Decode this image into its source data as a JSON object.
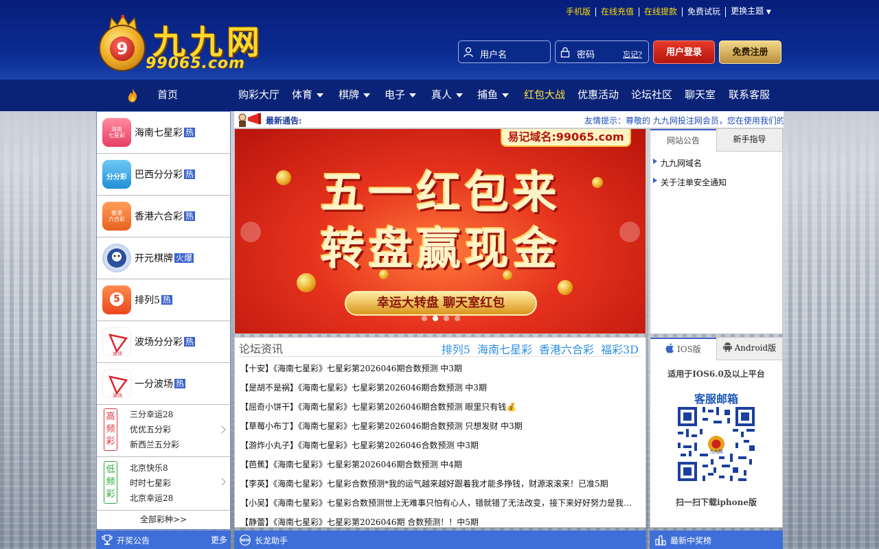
{
  "header": {
    "logo_cn": "九九网",
    "logo_en": "99065.com",
    "logo_ball_number": "9",
    "top_links": [
      "手机版",
      "在线充值",
      "在线提款",
      "免费试玩",
      "更换主题"
    ],
    "username_placeholder": "用户名",
    "password_placeholder": "密码",
    "forgot": "忘记?",
    "login_button": "用户登录",
    "register_button": "免费注册"
  },
  "nav": {
    "home": "首页",
    "items": [
      {
        "label": "购彩大厅",
        "dropdown": false,
        "highlight": false
      },
      {
        "label": "体育",
        "dropdown": true,
        "highlight": false
      },
      {
        "label": "棋牌",
        "dropdown": true,
        "highlight": false
      },
      {
        "label": "电子",
        "dropdown": true,
        "highlight": false
      },
      {
        "label": "真人",
        "dropdown": true,
        "highlight": false
      },
      {
        "label": "捕鱼",
        "dropdown": true,
        "highlight": false
      },
      {
        "label": "红包大战",
        "dropdown": false,
        "highlight": true
      },
      {
        "label": "优惠活动",
        "dropdown": false,
        "highlight": false
      },
      {
        "label": "论坛社区",
        "dropdown": false,
        "highlight": false
      },
      {
        "label": "聊天室",
        "dropdown": false,
        "highlight": false
      },
      {
        "label": "联系客服",
        "dropdown": false,
        "highlight": false
      }
    ]
  },
  "sidebar": {
    "games": [
      {
        "name": "海南七星彩",
        "badge": "热",
        "icon_text": "海南\n七星彩",
        "color": "#f0607a"
      },
      {
        "name": "巴西分分彩",
        "badge": "热",
        "icon_text": "分分彩",
        "color": "#35a7e8"
      },
      {
        "name": "香港六合彩",
        "badge": "热",
        "icon_text": "香港\n六合彩",
        "color": "#f27a3a"
      },
      {
        "name": "开元棋牌",
        "badge": "火爆",
        "icon_text": "",
        "color": "#e8eef8"
      },
      {
        "name": "排列5",
        "badge": "热",
        "icon_text": "5",
        "color": "#f2662e"
      },
      {
        "name": "波场分分彩",
        "badge": "热",
        "icon_text": "波场",
        "color": "#ffffff"
      },
      {
        "name": "一分波场",
        "badge": "热",
        "icon_text": "波场",
        "color": "#ffffff"
      }
    ],
    "groups": [
      {
        "tag": "高频彩",
        "color": "#d9363e",
        "items": [
          "三分幸运28",
          "优优五分彩",
          "新西兰五分彩"
        ]
      },
      {
        "tag": "低频彩",
        "color": "#2aa639",
        "items": [
          "北京快乐8",
          "时时七星彩",
          "北京幸运28"
        ]
      }
    ],
    "all_games": "全部彩种>>"
  },
  "notice": {
    "label": "最新通告:",
    "marquee": "友情提示：尊敬的 九九网投注网会员，您在使用我们的"
  },
  "banner": {
    "domain": "易记域名:99065.com",
    "line1": "五一红包来",
    "line2": "转盘赢现金",
    "pill": "幸运大转盘 聊天室红包"
  },
  "announcements": {
    "tabs": [
      "网站公告",
      "新手指导"
    ],
    "items": [
      "九九网域名",
      "关于注单安全通知"
    ]
  },
  "forum": {
    "title": "论坛资讯",
    "categories": [
      "排列5",
      "海南七星彩",
      "香港六合彩",
      "福彩3D"
    ],
    "posts": [
      "【十安】《海南七星彩》七星彩第2026046期合数预测 中3期",
      "【是胡不是祸】《海南七星彩》七星彩第2026046期合数预测 中3期",
      "【屈奇小饼干】《海南七星彩》七星彩第2026046期合数预测 眼里只有钱💰",
      "【草莓小布丁】《海南七星彩》七星彩第2026046期合数预测 只想发财 中3期",
      "【游炸小丸子】《海南七星彩》七星彩第2026046合数预测 中3期",
      "【芭蕉】《海南七星彩》七星彩第2026046期合数预测 中4期",
      "【李英】《海南七星彩》七星彩合数预测*我的运气越来越好跟着我才能多挣钱，财源滚滚来！已准5期",
      "【小吴】《海南七星彩》七星彩合数预测世上无难事只怕有心人，错就错了无法改变，接下来好好努力是我的目标",
      "【静蕾】《海南七星彩》七星彩第2026046期 合数预测！！中5期"
    ]
  },
  "app": {
    "tabs": [
      "IOS版",
      "Android版"
    ],
    "subtitle": "适用于IOS6.0及以上平台",
    "mailbox": "客服邮箱",
    "qr_center": "九九网",
    "scan": "扫一扫下载iphone版"
  },
  "bottom": {
    "draw": "开奖公告",
    "more": "更多",
    "dragon": "长龙助手",
    "dragon_icon": "NEW",
    "winners": "最新中奖榜"
  }
}
